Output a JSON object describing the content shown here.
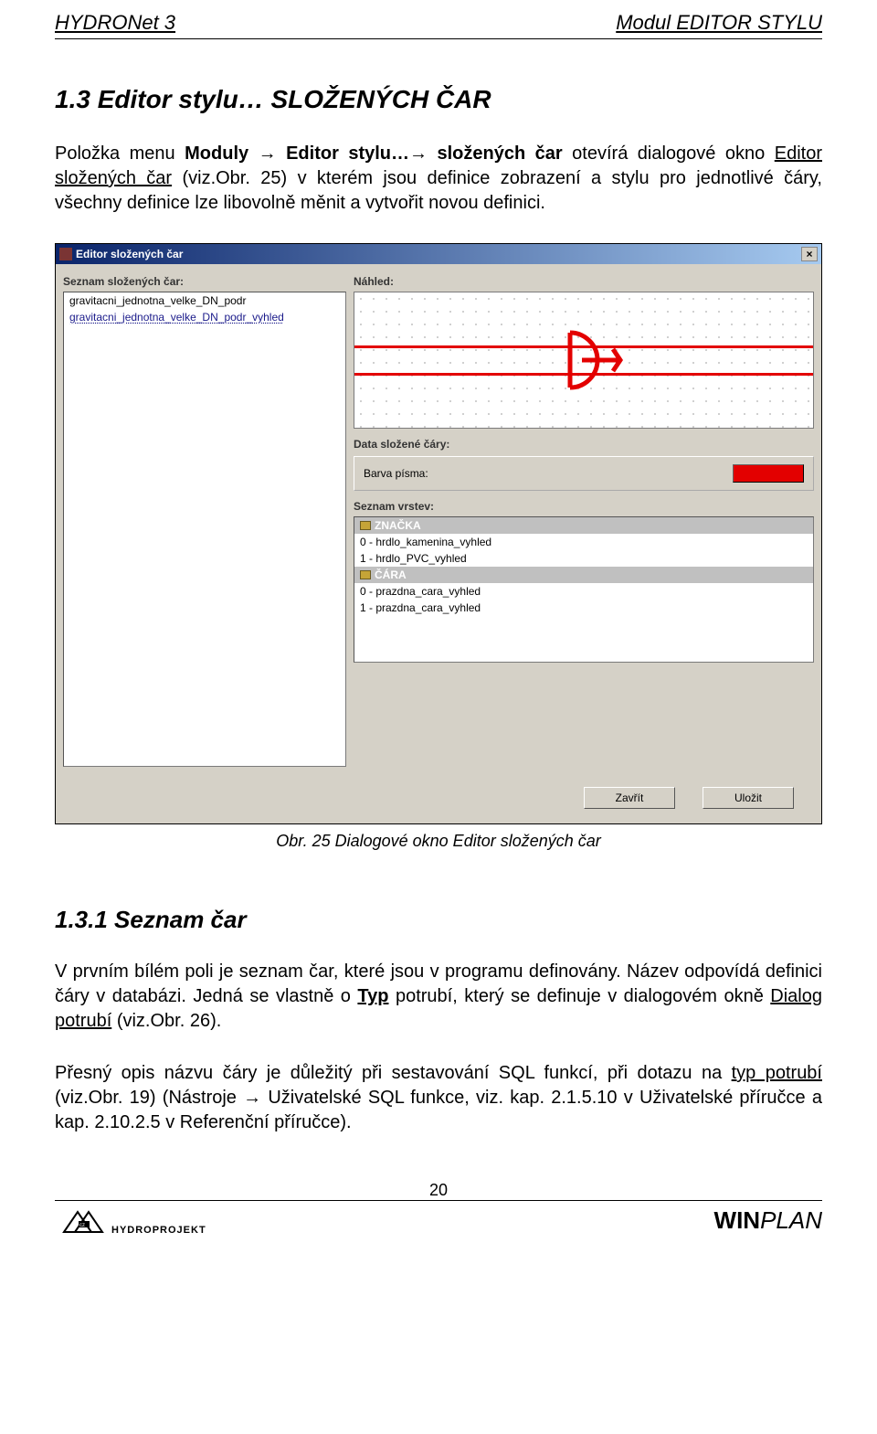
{
  "header": {
    "left": "HYDRONet 3",
    "right": "Modul  EDITOR STYLU"
  },
  "section1": {
    "title": "1.3  Editor stylu… SLOŽENÝCH ČAR",
    "p1_a": "Položka menu ",
    "p1_b": "Moduly → Editor stylu…→ složených čar",
    "p1_c": " otevírá dialogové okno ",
    "p1_d": "Editor složených čar",
    "p1_e": " (viz.Obr. 25) v kterém jsou definice zobrazení a stylu pro jednotlivé čáry, všechny definice lze libovolně měnit a vytvořit novou definici."
  },
  "dialog": {
    "title": "Editor složených čar",
    "left_label": "Seznam složených čar:",
    "list_items": [
      "gravitacni_jednotna_velke_DN_podr",
      "gravitacni_jednotna_velke_DN_podr_vyhled"
    ],
    "preview_label": "Náhled:",
    "data_label": "Data složené čáry:",
    "color_label": "Barva písma:",
    "layers_label": "Seznam vrstev:",
    "layers": {
      "group1": "ZNAČKA",
      "g1_items": [
        "0 - hrdlo_kamenina_vyhled",
        "1 - hrdlo_PVC_vyhled"
      ],
      "group2": "ČÁRA",
      "g2_items": [
        "0 - prazdna_cara_vyhled",
        "1 - prazdna_cara_vyhled"
      ]
    },
    "btn_close": "Zavřít",
    "btn_save": "Uložit"
  },
  "caption": "Obr. 25 Dialogové okno Editor složených čar",
  "section2": {
    "title": "1.3.1  Seznam čar",
    "p_a": "V prvním bílém poli je seznam čar, které jsou v programu definovány. Název odpovídá definici čáry v databázi. Jedná se vlastně o ",
    "p_typ": "Typ",
    "p_b": " potrubí, který se definuje v dialogovém okně ",
    "p_dialog": "Dialog potrubí",
    "p_c": " (viz.Obr. 26).",
    "p_d": "Přesný opis názvu čáry je důležitý při sestavování SQL funkcí, při dotazu na ",
    "p_typ2": "typ potrubí",
    "p_e": " (viz.Obr. 19)  (Nástroje → Uživatelské SQL funkce, viz. kap. 2.1.5.10 v Uživatelské příručce a kap. 2.10.2.5 v Referenční příručce)."
  },
  "page_number": "20",
  "footer_logo": "HYDROPROJEKT",
  "footer_brand_a": "WIN",
  "footer_brand_b": "PLAN"
}
